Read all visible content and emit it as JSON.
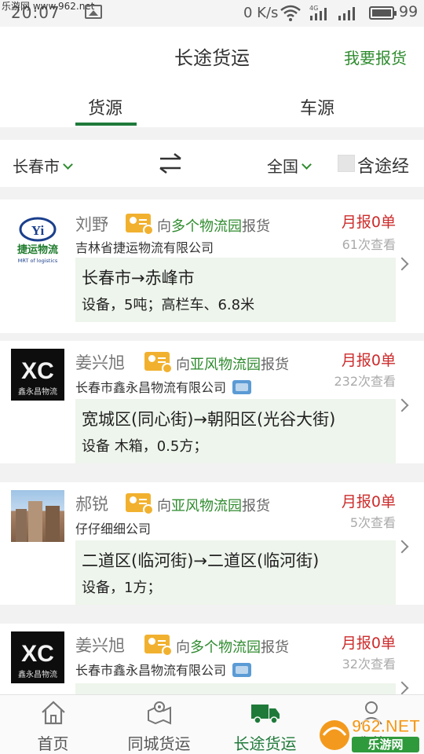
{
  "status_bar": {
    "site_text": "乐游网 www.962.net",
    "time": "20:07",
    "speed": "0 K/s",
    "network": "4G",
    "battery": "99"
  },
  "header": {
    "title": "长途货运",
    "action_label": "我要报货"
  },
  "tabs": {
    "goods": "货源",
    "vehicles": "车源"
  },
  "filter": {
    "from_city": "长春市",
    "to_region": "全国",
    "via_label": "含途经"
  },
  "listings": [
    {
      "name": "刘野",
      "report_prefix": "向",
      "park": "多个物流园",
      "report_suffix": "报货",
      "company": "吉林省捷运物流有限公司",
      "monthly": "月报0单",
      "views": "61次查看",
      "route": "长春市→赤峰市",
      "detail": "设备，5吨；高栏车、6.8米",
      "logo_text": "捷运物流",
      "logo_sub": "MRT of logistics",
      "logo_mark": "Yi"
    },
    {
      "name": "姜兴旭",
      "report_prefix": "向",
      "park": "亚风物流园",
      "report_suffix": "报货",
      "company": "长春市鑫永昌物流有限公司",
      "monthly": "月报0单",
      "views": "232次查看",
      "route": "宽城区(同心街)→朝阳区(光谷大街)",
      "detail": "设备 木箱，0.5方；",
      "logo_text": "鑫永昌物流",
      "logo_mark": "XC"
    },
    {
      "name": "郝锐",
      "report_prefix": "向",
      "park": "亚风物流园",
      "report_suffix": "报货",
      "company": "仔仔细细公司",
      "monthly": "月报0单",
      "views": "5次查看",
      "route": "二道区(临河街)→二道区(临河街)",
      "detail": "设备，1方；"
    },
    {
      "name": "姜兴旭",
      "report_prefix": "向",
      "park": "多个物流园",
      "report_suffix": "报货",
      "company": "长春市鑫永昌物流有限公司",
      "monthly": "月报0单",
      "views": "32次查看",
      "logo_text": "鑫永昌物流",
      "logo_mark": "XC"
    }
  ],
  "bottom_nav": {
    "home": "首页",
    "local": "同城货运",
    "longhaul": "长途货运",
    "mine": "我的"
  },
  "watermark": {
    "brand": "962.NET",
    "sub": "乐游网"
  },
  "colors": {
    "brand_green": "#1f7a3a",
    "accent_red": "#cc2b2b",
    "badge_orange": "#f1b12f",
    "route_bg": "#eef5ec"
  }
}
